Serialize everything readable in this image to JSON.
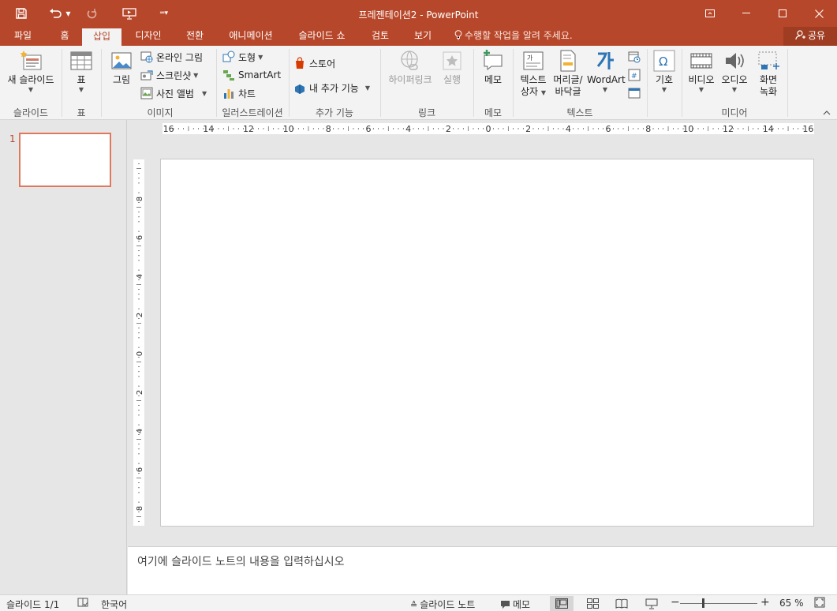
{
  "titlebar": {
    "title": "프레젠테이션2 - PowerPoint",
    "qat": {
      "save_icon": "save-icon",
      "undo_icon": "undo-icon",
      "redo_icon": "redo-icon",
      "present_icon": "present-from-beginning-icon",
      "customize_icon": "customize-qat-icon"
    },
    "window": {
      "ribbon_options_icon": "ribbon-display-options-icon",
      "minimize_icon": "minimize-icon",
      "maximize_icon": "maximize-icon",
      "close_icon": "close-icon"
    }
  },
  "tabs": {
    "items": [
      "파일",
      "홈",
      "삽입",
      "디자인",
      "전환",
      "애니메이션",
      "슬라이드 쇼",
      "검토",
      "보기"
    ],
    "active": "삽입",
    "tell_me": "수행할 작업을 알려 주세요.",
    "share": "공유"
  },
  "ribbon": {
    "groups": {
      "slides": "슬라이드",
      "table": "표",
      "images": "이미지",
      "illustrations": "일러스트레이션",
      "addins": "추가 기능",
      "links": "링크",
      "comments": "메모",
      "text": "텍스트",
      "symbols": "",
      "media": "미디어"
    },
    "buttons": {
      "new_slide": "새 슬라이드",
      "table": "표",
      "picture": "그림",
      "online_pictures": "온라인 그림",
      "screenshot": "스크린샷",
      "photo_album": "사진 앨범",
      "shapes": "도형",
      "smartart": "SmartArt",
      "chart": "차트",
      "store": "스토어",
      "my_addins": "내 추가 기능",
      "hyperlink": "하이퍼링크",
      "action": "실행",
      "comment": "메모",
      "textbox_l1": "텍스트",
      "textbox_l2": "상자",
      "header_footer_l1": "머리글/",
      "header_footer_l2": "바닥글",
      "wordart": "WordArt",
      "symbols": "기호",
      "video": "비디오",
      "audio": "오디오",
      "screen_rec_l1": "화면",
      "screen_rec_l2": "녹화"
    }
  },
  "ruler": {
    "h_labels": [
      "16",
      "14",
      "12",
      "10",
      "8",
      "6",
      "4",
      "2",
      "0",
      "2",
      "4",
      "6",
      "8",
      "10",
      "12",
      "14",
      "16"
    ],
    "v_labels": [
      "8",
      "6",
      "4",
      "2",
      "0",
      "2",
      "4",
      "6",
      "8"
    ]
  },
  "thumbnails": {
    "number": "1"
  },
  "notes": {
    "placeholder": "여기에 슬라이드 노트의 내용을 입력하십시오"
  },
  "status": {
    "slide_count": "슬라이드 1/1",
    "language": "한국어",
    "notes": "슬라이드 노트",
    "comments": "메모",
    "zoom": "65 %"
  }
}
